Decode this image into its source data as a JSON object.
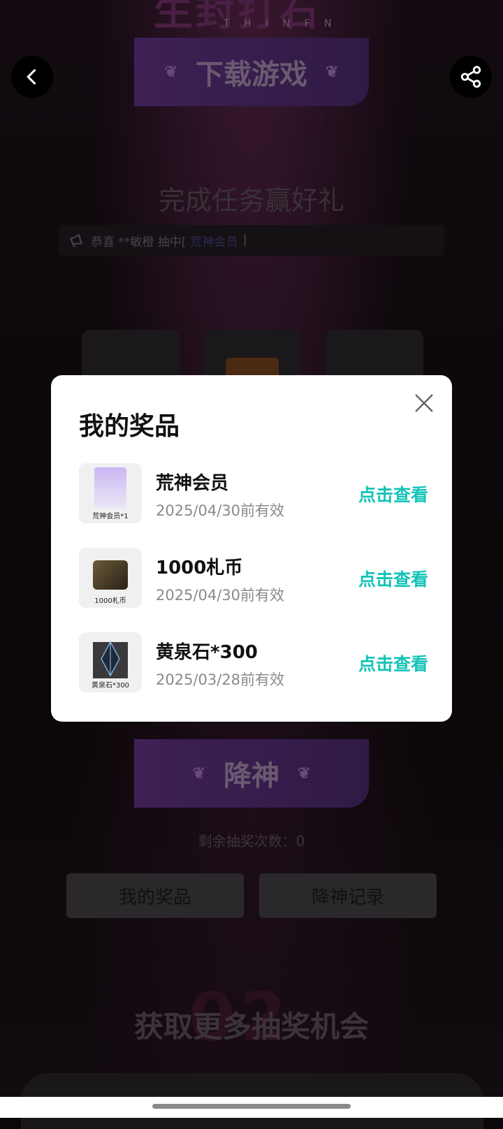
{
  "header": {
    "hero_title": "生封打石",
    "hero_subtitle": "T H I N F N"
  },
  "banners": {
    "download": "下载游戏",
    "summon": "降神"
  },
  "tasks": {
    "title": "完成任务赢好礼",
    "congrats_prefix": "恭喜 **敏橙 抽中[",
    "congrats_prize": "荒神会员",
    "congrats_suffix": "]"
  },
  "summon_section": {
    "remaining": "剩余抽奖次数：0",
    "my_prizes_button": "我的奖品",
    "summon_record_button": "降神记录"
  },
  "more_section": {
    "bg_number": "02",
    "title": "获取更多抽奖机会"
  },
  "modal": {
    "title": "我的奖品",
    "prizes": [
      {
        "name": "荒神会员",
        "valid": "2025/04/30前有效",
        "action": "点击查看",
        "thumb_caption": "荒神会员*1"
      },
      {
        "name": "1000札币",
        "valid": "2025/04/30前有效",
        "action": "点击查看",
        "thumb_caption": "1000札币"
      },
      {
        "name": "黄泉石*300",
        "valid": "2025/03/28前有效",
        "action": "点击查看",
        "thumb_caption": "黄泉石*300"
      }
    ]
  },
  "colors": {
    "accent": "#14c3b8",
    "background": "#0a0609",
    "modal_bg": "#ffffff"
  }
}
